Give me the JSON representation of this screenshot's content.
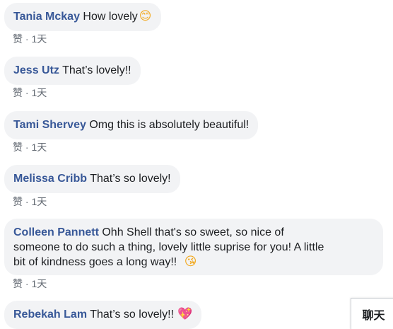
{
  "comments": [
    {
      "author": "Tania Mckay",
      "text": "How lovely",
      "emoji": "😊",
      "emoji_name": "smiling-face-icon",
      "like": "赞",
      "separator": "·",
      "time": "1天"
    },
    {
      "author": "Jess Utz",
      "text": "That’s lovely!!",
      "like": "赞",
      "separator": "·",
      "time": "1天"
    },
    {
      "author": "Tami Shervey",
      "text": "Omg this is absolutely beautiful!",
      "like": "赞",
      "separator": "·",
      "time": "1天"
    },
    {
      "author": "Melissa Cribb",
      "text": "That’s so lovely!",
      "like": "赞",
      "separator": "·",
      "time": "1天"
    },
    {
      "author": "Colleen Pannett",
      "text_line1": "Ohh Shell that's so sweet, so nice of",
      "text_line2": "someone to do such a thing, lovely little suprise for you! A little",
      "text_line3": "bit of kindness goes a long way!!",
      "emoji": "😘",
      "emoji_name": "face-blowing-kiss-icon",
      "like": "赞",
      "separator": "·",
      "time": "1天"
    },
    {
      "author": "Rebekah Lam",
      "text": "That’s so lovely!!",
      "emoji": "💖",
      "emoji_name": "sparkling-heart-icon"
    }
  ],
  "chat_tab": {
    "label": "聊天"
  },
  "colors": {
    "author": "#385898",
    "bubble": "#f2f3f5",
    "meta": "#606770"
  }
}
